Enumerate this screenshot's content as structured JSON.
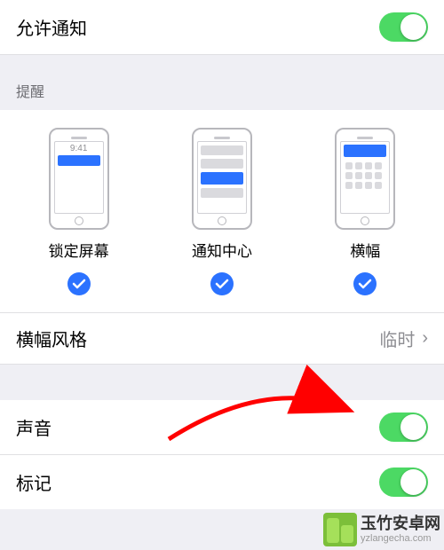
{
  "allow": {
    "label": "允许通知",
    "enabled": true
  },
  "section_alerts_header": "提醒",
  "alerts": {
    "lock_time": "9:41",
    "items": [
      {
        "label": "锁定屏幕",
        "checked": true
      },
      {
        "label": "通知中心",
        "checked": true
      },
      {
        "label": "横幅",
        "checked": true
      }
    ]
  },
  "banner_style": {
    "label": "横幅风格",
    "value": "临时"
  },
  "sound": {
    "label": "声音",
    "enabled": true
  },
  "badges": {
    "label": "标记",
    "enabled": true
  },
  "icons": {
    "chevron": "›"
  },
  "watermark": {
    "title": "玉竹安卓网",
    "url": "yzlangecha.com"
  }
}
